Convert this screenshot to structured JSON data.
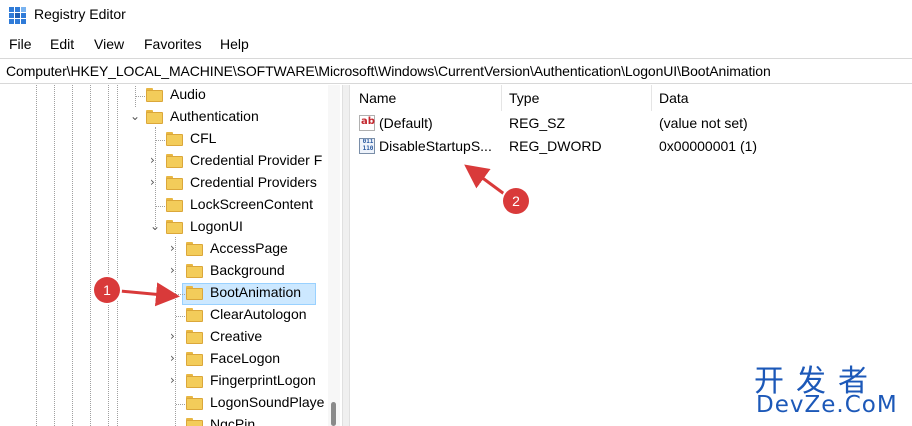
{
  "window": {
    "title": "Registry Editor"
  },
  "menu": [
    "File",
    "Edit",
    "View",
    "Favorites",
    "Help"
  ],
  "address": "Computer\\HKEY_LOCAL_MACHINE\\SOFTWARE\\Microsoft\\Windows\\CurrentVersion\\Authentication\\LogonUI\\BootAnimation",
  "tree": {
    "items": [
      {
        "label": "Audio",
        "expand": "none",
        "selected": false
      },
      {
        "label": "Authentication",
        "expand": "expanded",
        "selected": false
      },
      {
        "label": "CFL",
        "expand": "none",
        "selected": false
      },
      {
        "label": "Credential Provider F",
        "expand": "collapsed",
        "selected": false
      },
      {
        "label": "Credential Providers",
        "expand": "collapsed",
        "selected": false
      },
      {
        "label": "LockScreenContent",
        "expand": "none",
        "selected": false
      },
      {
        "label": "LogonUI",
        "expand": "expanded",
        "selected": false
      },
      {
        "label": "AccessPage",
        "expand": "collapsed",
        "selected": false
      },
      {
        "label": "Background",
        "expand": "collapsed",
        "selected": false
      },
      {
        "label": "BootAnimation",
        "expand": "none",
        "selected": true
      },
      {
        "label": "ClearAutologon",
        "expand": "none",
        "selected": false
      },
      {
        "label": "Creative",
        "expand": "collapsed",
        "selected": false
      },
      {
        "label": "FaceLogon",
        "expand": "collapsed",
        "selected": false
      },
      {
        "label": "FingerprintLogon",
        "expand": "collapsed",
        "selected": false
      },
      {
        "label": "LogonSoundPlaye",
        "expand": "none",
        "selected": false
      },
      {
        "label": "NgcPin",
        "expand": "none",
        "selected": false
      }
    ]
  },
  "values": {
    "columns": {
      "name": "Name",
      "type": "Type",
      "data": "Data"
    },
    "rows": [
      {
        "icon": "string-value-icon",
        "name": "(Default)",
        "type": "REG_SZ",
        "data": "(value not set)"
      },
      {
        "icon": "binary-value-icon",
        "name": "DisableStartupS...",
        "type": "REG_DWORD",
        "data": "0x00000001 (1)"
      }
    ]
  },
  "icons": {
    "string_glyph": "ab",
    "binary_glyph": "011\n110"
  },
  "annotations": {
    "badge1": "1",
    "badge2": "2",
    "color": "#d93a3a"
  },
  "watermark": {
    "cn": "开发者",
    "en": "DevZe.CoM"
  }
}
